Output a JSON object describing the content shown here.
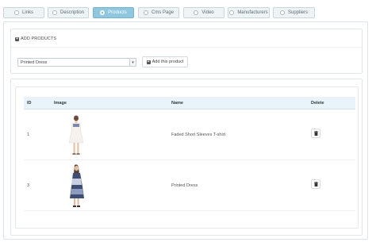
{
  "tabs": [
    {
      "label": "Links",
      "active": false
    },
    {
      "label": "Description",
      "active": false
    },
    {
      "label": "Products",
      "active": true
    },
    {
      "label": "Cms Page",
      "active": false
    },
    {
      "label": "Video",
      "active": false
    },
    {
      "label": "Manufacturers",
      "active": false
    },
    {
      "label": "Suppliers",
      "active": false
    }
  ],
  "add_panel": {
    "heading": "ADD PRODUCTS",
    "select_value": "Printed Dress",
    "add_button_label": "Add this product"
  },
  "table": {
    "headers": {
      "id": "ID",
      "image": "Image",
      "name": "Name",
      "delete": "Delete"
    },
    "rows": [
      {
        "id": "1",
        "name": "Faded Short Sleeves T-shirt",
        "image_icon": "product-photo-white-dress"
      },
      {
        "id": "3",
        "name": "Printed Dress",
        "image_icon": "product-photo-printed-dress"
      }
    ]
  },
  "colors": {
    "accent": "#8fc7df",
    "header_bg": "#e9f4fa"
  }
}
